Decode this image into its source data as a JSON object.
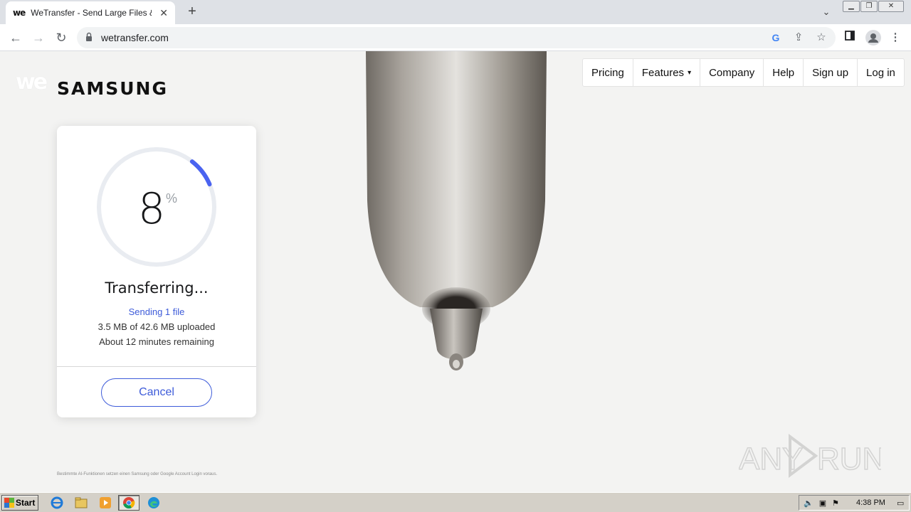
{
  "browser": {
    "tab_title": "WeTransfer - Send Large Files & Share Photos Online",
    "tab_favicon": "we",
    "url": "wetransfer.com"
  },
  "page": {
    "we_logo": "we",
    "brand_logo": "SAMSUNG",
    "nav": {
      "pricing": "Pricing",
      "features": "Features",
      "company": "Company",
      "help": "Help",
      "signup": "Sign up",
      "login": "Log in"
    },
    "transfer": {
      "progress_value": "8",
      "progress_unit": "%",
      "progress_fraction": 0.08,
      "status": "Transferring...",
      "sending": "Sending 1 file",
      "uploaded": "3.5 MB of 42.6 MB uploaded",
      "remaining": "About 12 minutes remaining",
      "cancel": "Cancel"
    },
    "disclaimer": "Bestimmte AI-Funktionen setzen einen Samsung oder Google Account Login voraus.",
    "watermark": "ANY RUN"
  },
  "taskbar": {
    "start": "Start",
    "clock": "4:38 PM"
  },
  "colors": {
    "accent": "#3d5bd9",
    "progress_track": "#e9ecf1",
    "progress_fill": "#4a63f0"
  }
}
